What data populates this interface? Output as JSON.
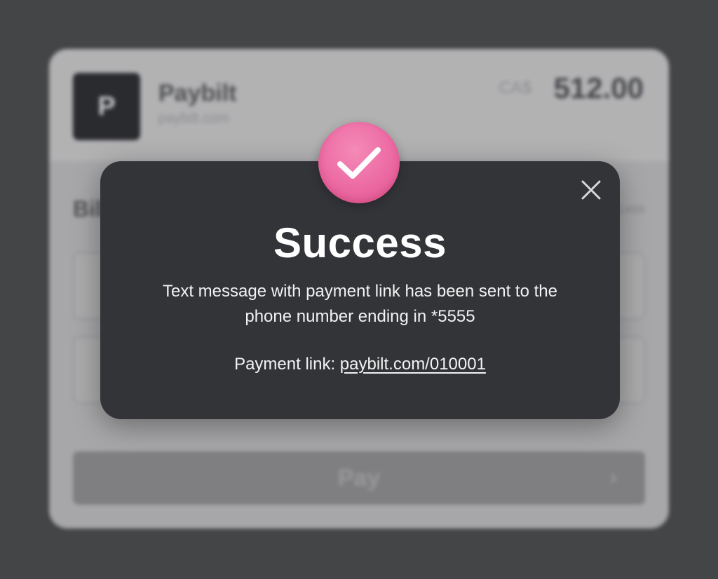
{
  "background_card": {
    "merchant_initial": "P",
    "merchant_name": "Paybilt",
    "merchant_url": "paybilt.com",
    "currency": "CA$",
    "amount": "512.00",
    "section_title": "Bill Pay",
    "section_aside": "Less",
    "pay_button_label": "Pay",
    "pay_chevron": "›"
  },
  "modal": {
    "title": "Success",
    "message": "Text message with payment link has been sent to the phone number ending in *5555",
    "link_prefix": "Payment link:",
    "link_text": "paybilt.com/010001",
    "badge_icon": "checkmark-icon",
    "close_icon": "close-icon"
  },
  "colors": {
    "badge_pink": "#ec6aa3",
    "modal_background": "#333438",
    "page_background": "#48494c"
  }
}
